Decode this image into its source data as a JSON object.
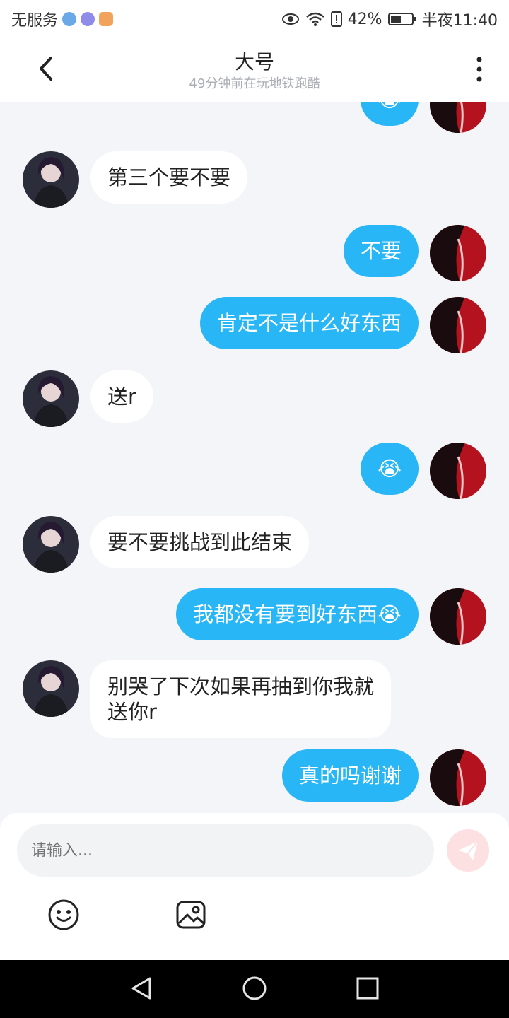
{
  "status_bar": {
    "carrier": "无服务",
    "battery": "42%",
    "time": "半夜11:40",
    "icons": [
      "vpn-icon",
      "music-icon",
      "app-icon",
      "eye-icon",
      "wifi-icon",
      "sim-alert-icon",
      "battery-icon"
    ]
  },
  "header": {
    "title": "大号",
    "subtitle": "49分钟前在玩地铁跑酷"
  },
  "messages": [
    {
      "from": "other",
      "text": "第三个要不要"
    },
    {
      "from": "me",
      "text": "不要"
    },
    {
      "from": "me",
      "text": "肯定不是什么好东西"
    },
    {
      "from": "other",
      "text": "送r"
    },
    {
      "from": "me",
      "text": "😭"
    },
    {
      "from": "other",
      "text": "要不要挑战到此结束"
    },
    {
      "from": "me",
      "text": "我都没有要到好东西😭"
    },
    {
      "from": "other",
      "text": "别哭了下次如果再抽到你我就\n送你r"
    },
    {
      "from": "me",
      "text": "真的吗谢谢"
    }
  ],
  "top_partial_message": {
    "from": "me",
    "text": "😭"
  },
  "input": {
    "placeholder": "请输入..."
  },
  "colors": {
    "my_bubble": "#29b6f6",
    "other_bubble": "#ffffff",
    "background": "#f3f5f8",
    "send_button": "#fde0e2"
  }
}
